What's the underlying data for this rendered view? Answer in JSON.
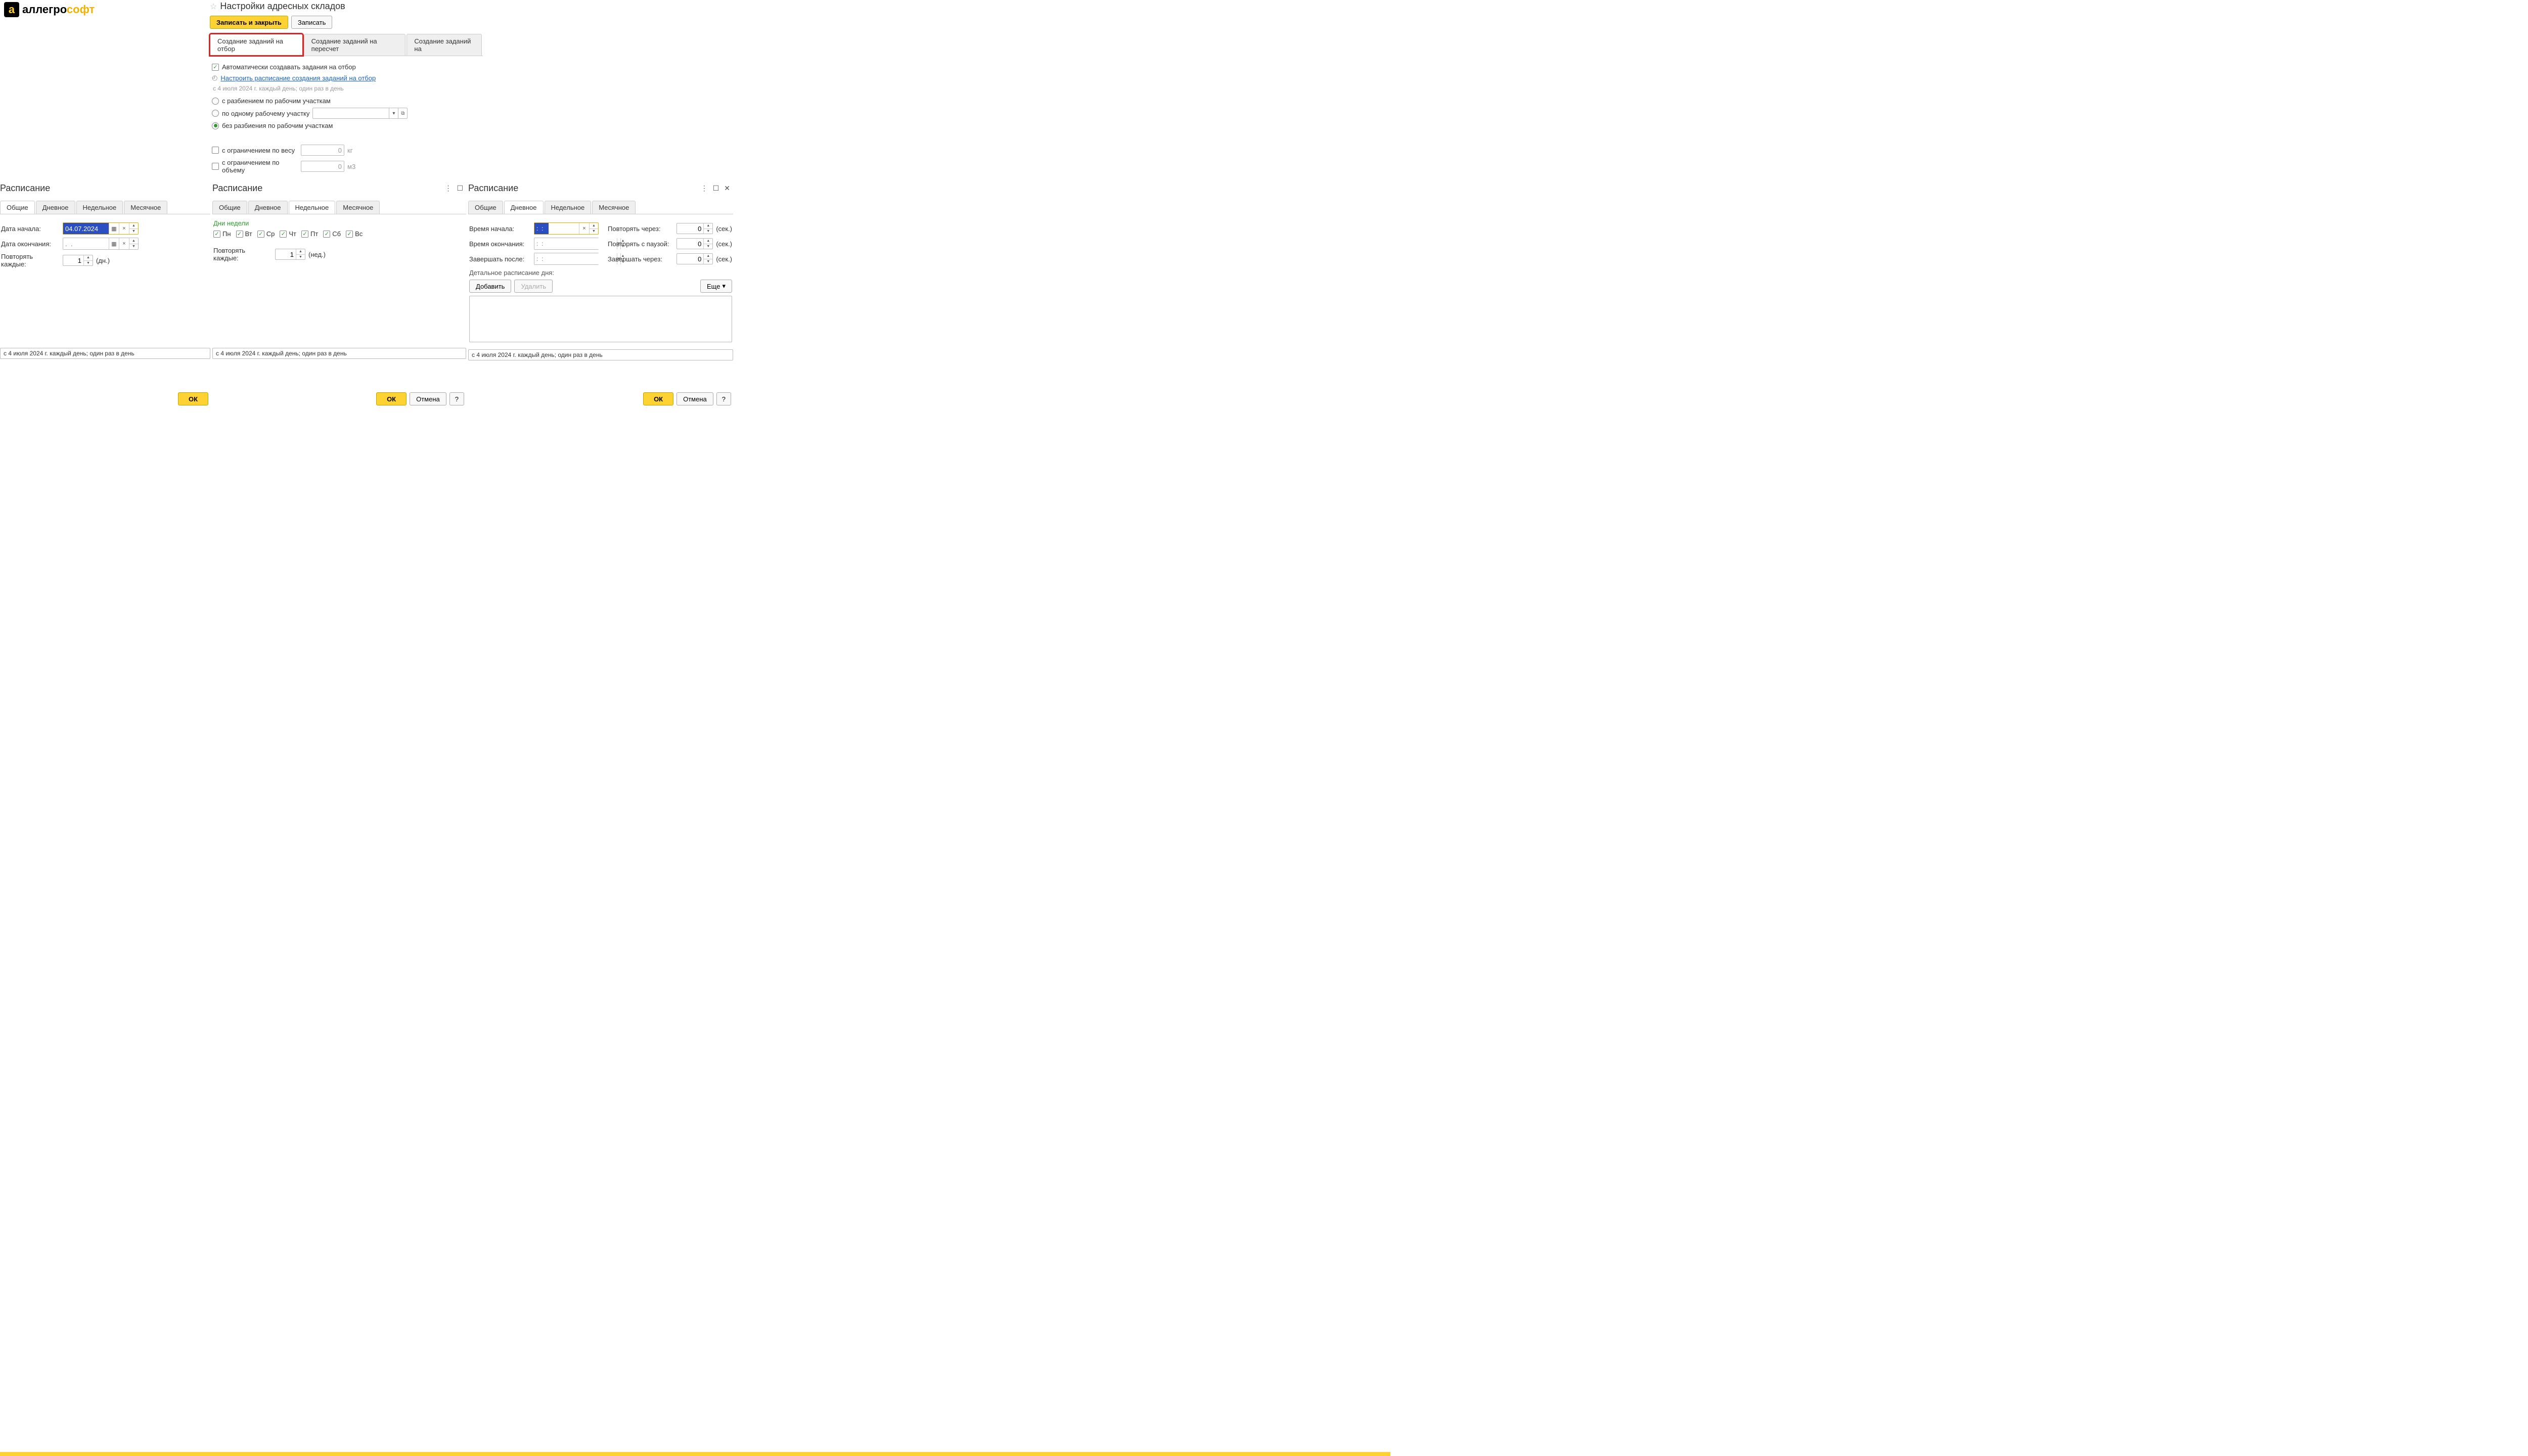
{
  "brand": {
    "mark": "a",
    "text1": "аллегро",
    "text2": "софт"
  },
  "page": {
    "title": "Настройки адресных складов",
    "buttons": {
      "save_close": "Записать и закрыть",
      "save": "Записать"
    },
    "tabs": {
      "t1": "Создание заданий на отбор",
      "t2": "Создание заданий на пересчет",
      "t3": "Создание заданий на"
    },
    "auto_create": "Автоматически создавать задания на отбор",
    "schedule_link": "Настроить расписание создания заданий на отбор",
    "schedule_note": "с 4 июля 2024 г. каждый день; один раз в день",
    "radio1": "с разбиением по рабочим участкам",
    "radio2": "по одному рабочему участку",
    "radio3": "без разбиения по рабочим участкам",
    "weight_lbl": "с ограничением по весу",
    "weight_val": "0",
    "weight_unit": "кг",
    "volume_lbl": "с ограничением по объему",
    "volume_val": "0",
    "volume_unit": "м3",
    "dropdown_caret": "▾",
    "dropdown_open": "⧉"
  },
  "sched_title": "Расписание",
  "tabs_s": {
    "common": "Общие",
    "daily": "Дневное",
    "weekly": "Недельное",
    "monthly": "Месячное"
  },
  "s1": {
    "start_lbl": "Дата начала:",
    "start_val": "04.07.2024",
    "end_lbl": "Дата окончания:",
    "end_ph": ".  .",
    "repeat_lbl": "Повторять каждые:",
    "repeat_val": "1",
    "repeat_unit": "(дн.)",
    "status": "с 4 июля 2024 г. каждый день; один раз в день",
    "ok": "ОК"
  },
  "s2": {
    "days_title": "Дни недели",
    "days": {
      "mon": "Пн",
      "tue": "Вт",
      "wed": "Ср",
      "thu": "Чт",
      "fri": "Пт",
      "sat": "Сб",
      "sun": "Вс"
    },
    "repeat_lbl": "Повторять каждые:",
    "repeat_val": "1",
    "repeat_unit": "(нед.)",
    "status": "с 4 июля 2024 г. каждый день; один раз в день",
    "ok": "ОК",
    "cancel": "Отмена",
    "help": "?"
  },
  "s3": {
    "time_start": "Время начала:",
    "time_start_hl": ":  :",
    "time_end": "Время окончания:",
    "time_end_ph": ":  :",
    "finish_after": "Завершать после:",
    "repeat_every": "Повторять через:",
    "repeat_pause": "Повторять с паузой:",
    "finish_in": "Завершать через:",
    "num0": "0",
    "sec": "(сек.)",
    "detail_title": "Детальное расписание дня:",
    "add": "Добавить",
    "del": "Удалить",
    "more": "Еще",
    "status": "с 4 июля 2024 г. каждый день; один раз в день",
    "ok": "ОК",
    "cancel": "Отмена",
    "help": "?"
  },
  "icons": {
    "star": "☆",
    "clock": "◴",
    "cal": "📅",
    "x": "×",
    "up": "▲",
    "dn": "▼",
    "menu": "⋮",
    "max": "☐",
    "close": "✕",
    "caret": "▾"
  }
}
